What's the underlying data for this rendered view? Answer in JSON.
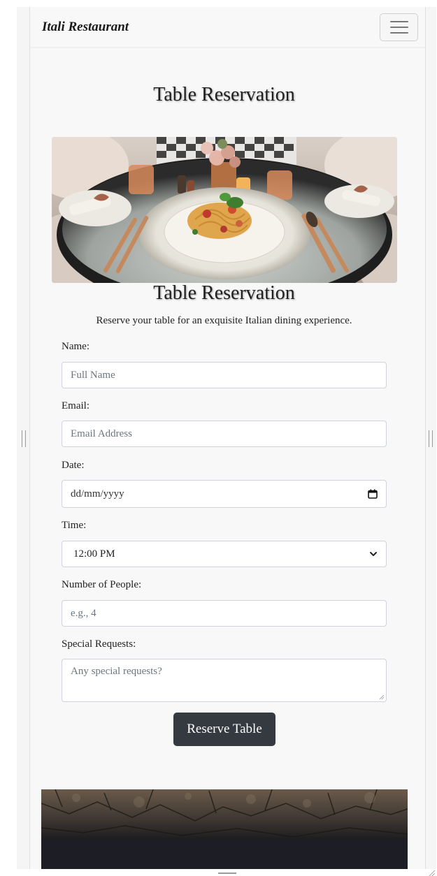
{
  "navbar": {
    "brand": "Itali Restaurant",
    "menu_icon": "hamburger-menu-icon"
  },
  "page": {
    "title": "Table Reservation"
  },
  "hero_image": {
    "subject": "plate of pasta on an elegantly set restaurant table"
  },
  "form": {
    "title": "Table Reservation",
    "subtitle": "Reserve your table for an exquisite Italian dining experience.",
    "fields": {
      "name": {
        "label": "Name:",
        "placeholder": "Full Name",
        "value": ""
      },
      "email": {
        "label": "Email:",
        "placeholder": "Email Address",
        "value": ""
      },
      "date": {
        "label": "Date:",
        "placeholder": "dd/mm/yyyy",
        "icon": "calendar-icon"
      },
      "time": {
        "label": "Time:",
        "selected": "12:00 PM",
        "icon": "chevron-down-icon"
      },
      "people": {
        "label": "Number of People:",
        "placeholder": "e.g., 4",
        "value": ""
      },
      "requests": {
        "label": "Special Requests:",
        "placeholder": "Any special requests?",
        "value": ""
      }
    },
    "submit_label": "Reserve Table"
  },
  "footer_image": {
    "subject": "dark rock texture"
  },
  "colors": {
    "page_bg": "#f8f8f8",
    "button_bg": "#343a40",
    "button_text": "#ffffff",
    "input_border": "#ced4da",
    "placeholder": "#6c757d"
  }
}
